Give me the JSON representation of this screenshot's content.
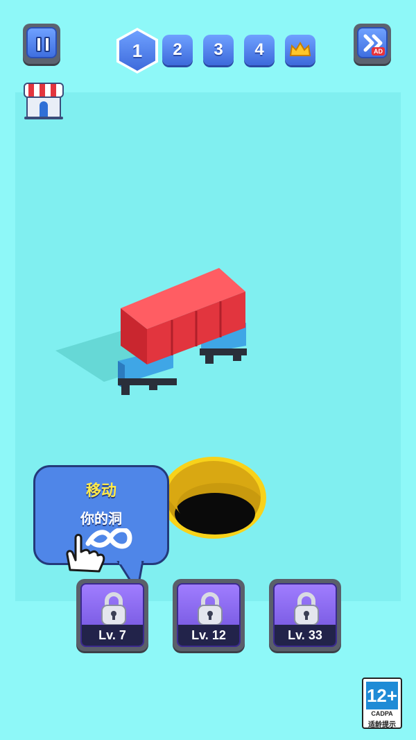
{
  "levels": {
    "current": "1",
    "items": [
      "2",
      "3",
      "4"
    ],
    "final_icon": "crown-icon"
  },
  "toolbar": {
    "pause_icon": "pause-icon",
    "skip_icon": "fast-forward-icon",
    "skip_ad_label": "AD",
    "shop_icon": "shop-icon"
  },
  "tutorial": {
    "title": "移动",
    "subtitle": "你的洞",
    "gesture_icon": "hand-pointer-infinity-icon"
  },
  "skins": [
    {
      "label": "Lv. 7",
      "icon": "lock-icon"
    },
    {
      "label": "Lv. 12",
      "icon": "lock-icon"
    },
    {
      "label": "Lv. 33",
      "icon": "lock-icon"
    }
  ],
  "age_rating": {
    "value": "12+",
    "org": "CADPA",
    "note": "适龄提示"
  },
  "colors": {
    "background": "#8ef8f8",
    "playfield": "#80eff0",
    "button_blue": "#4f86e8",
    "container_red": "#e2353e",
    "hole_rim": "#f8d21a"
  }
}
